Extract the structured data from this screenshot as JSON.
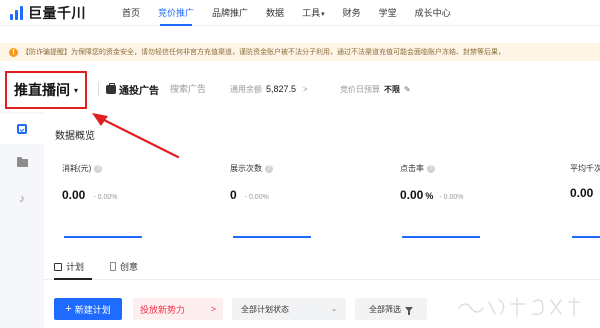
{
  "topnav": {
    "logo": "巨量千川",
    "items": [
      {
        "label": "首页"
      },
      {
        "label": "竞价推广"
      },
      {
        "label": "品牌推广"
      },
      {
        "label": "数据"
      },
      {
        "label": "工具"
      },
      {
        "label": "财务"
      },
      {
        "label": "学堂"
      },
      {
        "label": "成长中心"
      }
    ],
    "active_index": 1,
    "tools_caret": "▾"
  },
  "warning": {
    "text": "【防诈骗提醒】为保障您的资金安全，请勿轻信任何非官方充值渠道，谨防资金账户被不法分子利用，通过不法渠道充值可能会面临账户冻结、封禁等后果，"
  },
  "subheader": {
    "plan_select": "推直播间",
    "plan_caret": "▾",
    "ad_label": "通投广告",
    "search_ad": "搜索广告",
    "balance_label": "通用余额",
    "balance_value": "5,827.5",
    "balance_arrow": ">",
    "budget_label": "竞价日预算",
    "budget_value": "不限"
  },
  "main": {
    "section_title": "数据概览",
    "metrics": [
      {
        "label": "消耗(元)",
        "value": "0.00",
        "unit": "",
        "change": "- 0.00%"
      },
      {
        "label": "展示次数",
        "value": "0",
        "unit": "",
        "change": "- 0.00%"
      },
      {
        "label": "点击率",
        "value": "0.00",
        "unit": "%",
        "change": "- 0.00%"
      },
      {
        "label": "平均千次展现费用",
        "value": "0.00",
        "unit": "",
        "change": ""
      }
    ],
    "tabs": [
      {
        "label": "计划"
      },
      {
        "label": "创意"
      }
    ],
    "actions": {
      "new_plan": "新建计划",
      "new_plan_plus": "+",
      "promo": "投放新势力",
      "promo_arrow": ">",
      "status_select": "全部计划状态",
      "status_caret": "⌄",
      "filter": "全部筛选"
    }
  },
  "colors": {
    "accent": "#1f6bff",
    "annotation": "#e02020",
    "warning_bg": "#fff5e6"
  }
}
